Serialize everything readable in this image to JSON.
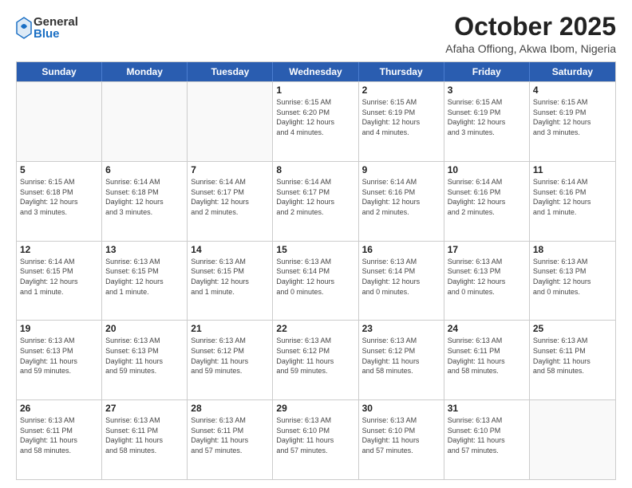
{
  "logo": {
    "general": "General",
    "blue": "Blue"
  },
  "title": "October 2025",
  "subtitle": "Afaha Offiong, Akwa Ibom, Nigeria",
  "header_days": [
    "Sunday",
    "Monday",
    "Tuesday",
    "Wednesday",
    "Thursday",
    "Friday",
    "Saturday"
  ],
  "weeks": [
    [
      {
        "day": "",
        "info": ""
      },
      {
        "day": "",
        "info": ""
      },
      {
        "day": "",
        "info": ""
      },
      {
        "day": "1",
        "info": "Sunrise: 6:15 AM\nSunset: 6:20 PM\nDaylight: 12 hours\nand 4 minutes."
      },
      {
        "day": "2",
        "info": "Sunrise: 6:15 AM\nSunset: 6:19 PM\nDaylight: 12 hours\nand 4 minutes."
      },
      {
        "day": "3",
        "info": "Sunrise: 6:15 AM\nSunset: 6:19 PM\nDaylight: 12 hours\nand 3 minutes."
      },
      {
        "day": "4",
        "info": "Sunrise: 6:15 AM\nSunset: 6:19 PM\nDaylight: 12 hours\nand 3 minutes."
      }
    ],
    [
      {
        "day": "5",
        "info": "Sunrise: 6:15 AM\nSunset: 6:18 PM\nDaylight: 12 hours\nand 3 minutes."
      },
      {
        "day": "6",
        "info": "Sunrise: 6:14 AM\nSunset: 6:18 PM\nDaylight: 12 hours\nand 3 minutes."
      },
      {
        "day": "7",
        "info": "Sunrise: 6:14 AM\nSunset: 6:17 PM\nDaylight: 12 hours\nand 2 minutes."
      },
      {
        "day": "8",
        "info": "Sunrise: 6:14 AM\nSunset: 6:17 PM\nDaylight: 12 hours\nand 2 minutes."
      },
      {
        "day": "9",
        "info": "Sunrise: 6:14 AM\nSunset: 6:16 PM\nDaylight: 12 hours\nand 2 minutes."
      },
      {
        "day": "10",
        "info": "Sunrise: 6:14 AM\nSunset: 6:16 PM\nDaylight: 12 hours\nand 2 minutes."
      },
      {
        "day": "11",
        "info": "Sunrise: 6:14 AM\nSunset: 6:16 PM\nDaylight: 12 hours\nand 1 minute."
      }
    ],
    [
      {
        "day": "12",
        "info": "Sunrise: 6:14 AM\nSunset: 6:15 PM\nDaylight: 12 hours\nand 1 minute."
      },
      {
        "day": "13",
        "info": "Sunrise: 6:13 AM\nSunset: 6:15 PM\nDaylight: 12 hours\nand 1 minute."
      },
      {
        "day": "14",
        "info": "Sunrise: 6:13 AM\nSunset: 6:15 PM\nDaylight: 12 hours\nand 1 minute."
      },
      {
        "day": "15",
        "info": "Sunrise: 6:13 AM\nSunset: 6:14 PM\nDaylight: 12 hours\nand 0 minutes."
      },
      {
        "day": "16",
        "info": "Sunrise: 6:13 AM\nSunset: 6:14 PM\nDaylight: 12 hours\nand 0 minutes."
      },
      {
        "day": "17",
        "info": "Sunrise: 6:13 AM\nSunset: 6:13 PM\nDaylight: 12 hours\nand 0 minutes."
      },
      {
        "day": "18",
        "info": "Sunrise: 6:13 AM\nSunset: 6:13 PM\nDaylight: 12 hours\nand 0 minutes."
      }
    ],
    [
      {
        "day": "19",
        "info": "Sunrise: 6:13 AM\nSunset: 6:13 PM\nDaylight: 11 hours\nand 59 minutes."
      },
      {
        "day": "20",
        "info": "Sunrise: 6:13 AM\nSunset: 6:13 PM\nDaylight: 11 hours\nand 59 minutes."
      },
      {
        "day": "21",
        "info": "Sunrise: 6:13 AM\nSunset: 6:12 PM\nDaylight: 11 hours\nand 59 minutes."
      },
      {
        "day": "22",
        "info": "Sunrise: 6:13 AM\nSunset: 6:12 PM\nDaylight: 11 hours\nand 59 minutes."
      },
      {
        "day": "23",
        "info": "Sunrise: 6:13 AM\nSunset: 6:12 PM\nDaylight: 11 hours\nand 58 minutes."
      },
      {
        "day": "24",
        "info": "Sunrise: 6:13 AM\nSunset: 6:11 PM\nDaylight: 11 hours\nand 58 minutes."
      },
      {
        "day": "25",
        "info": "Sunrise: 6:13 AM\nSunset: 6:11 PM\nDaylight: 11 hours\nand 58 minutes."
      }
    ],
    [
      {
        "day": "26",
        "info": "Sunrise: 6:13 AM\nSunset: 6:11 PM\nDaylight: 11 hours\nand 58 minutes."
      },
      {
        "day": "27",
        "info": "Sunrise: 6:13 AM\nSunset: 6:11 PM\nDaylight: 11 hours\nand 58 minutes."
      },
      {
        "day": "28",
        "info": "Sunrise: 6:13 AM\nSunset: 6:11 PM\nDaylight: 11 hours\nand 57 minutes."
      },
      {
        "day": "29",
        "info": "Sunrise: 6:13 AM\nSunset: 6:10 PM\nDaylight: 11 hours\nand 57 minutes."
      },
      {
        "day": "30",
        "info": "Sunrise: 6:13 AM\nSunset: 6:10 PM\nDaylight: 11 hours\nand 57 minutes."
      },
      {
        "day": "31",
        "info": "Sunrise: 6:13 AM\nSunset: 6:10 PM\nDaylight: 11 hours\nand 57 minutes."
      },
      {
        "day": "",
        "info": ""
      }
    ]
  ]
}
